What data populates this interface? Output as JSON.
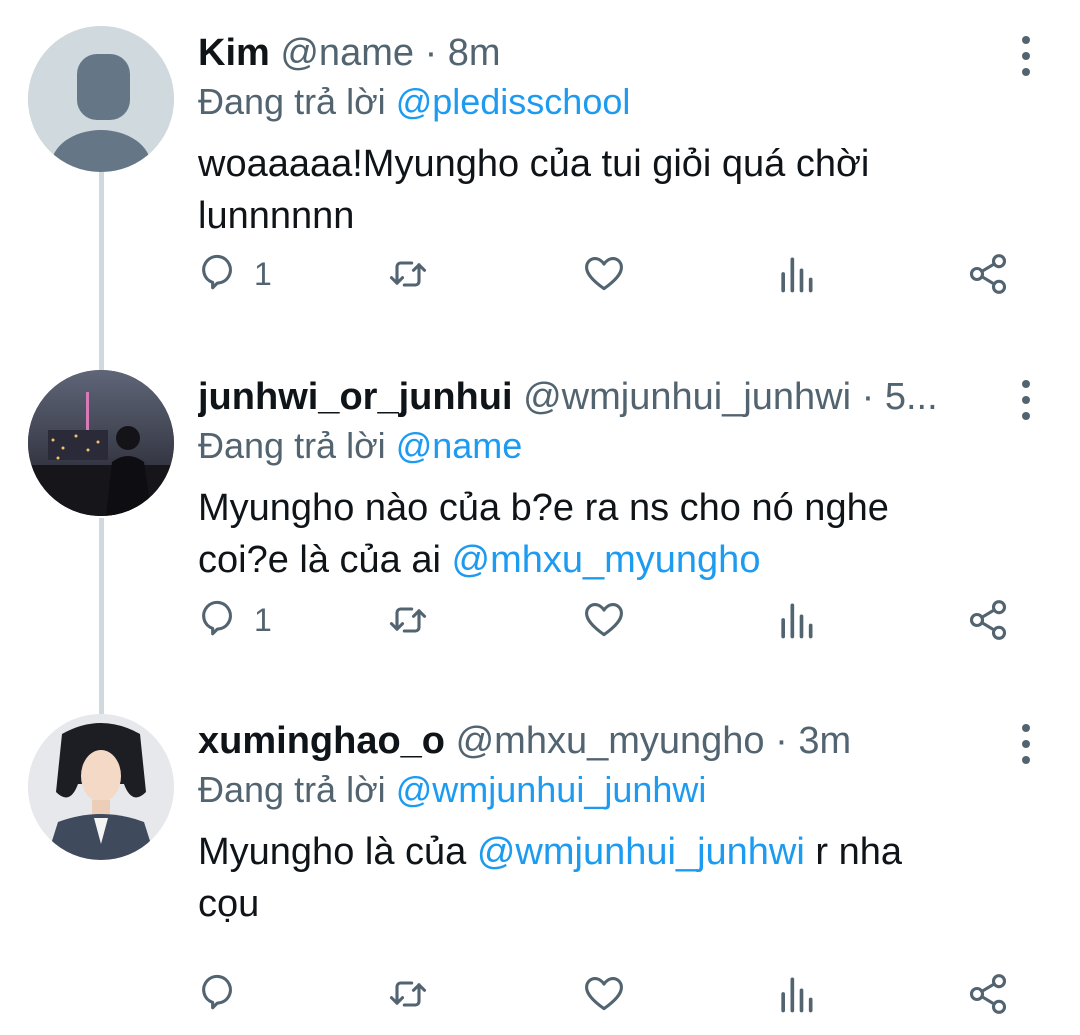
{
  "colors": {
    "link": "#1d9bf0",
    "secondary_text": "#536471",
    "thread_line": "#cfd9de"
  },
  "tweets": [
    {
      "display_name": "Kim",
      "handle": "@name",
      "separator": "·",
      "time": "8m",
      "replying_prefix": "Đang trả lời",
      "replying_to": "@pledisschool",
      "text_line1": "woaaaaa!Myungho của tui giỏi quá chời",
      "text_line2": "lunnnnnn",
      "reply_count": "1",
      "avatar_icon": "default-avatar-icon"
    },
    {
      "display_name": "junhwi_or_junhui",
      "handle": "@wmjunhui_junhwi",
      "separator": "·",
      "time": "5...",
      "replying_prefix": "Đang trả lời",
      "replying_to": "@name",
      "text_line1": "Myungho nào của b?e ra ns cho nó nghe",
      "text_line2_prefix": "coi?e là của ai",
      "text_line2_mention": "@mhxu_myungho",
      "reply_count": "1",
      "avatar_icon": "user-photo-avatar"
    },
    {
      "display_name": "xuminghao_o",
      "handle": "@mhxu_myungho",
      "separator": "·",
      "time": "3m",
      "replying_prefix": "Đang trả lời",
      "replying_to": "@wmjunhui_junhwi",
      "text_line1_prefix": "Myungho là của",
      "text_line1_mention": "@wmjunhui_junhwi",
      "text_line1_suffix": "r nha",
      "text_line2": "cọu",
      "reply_count": "",
      "avatar_icon": "user-photo-avatar"
    }
  ]
}
